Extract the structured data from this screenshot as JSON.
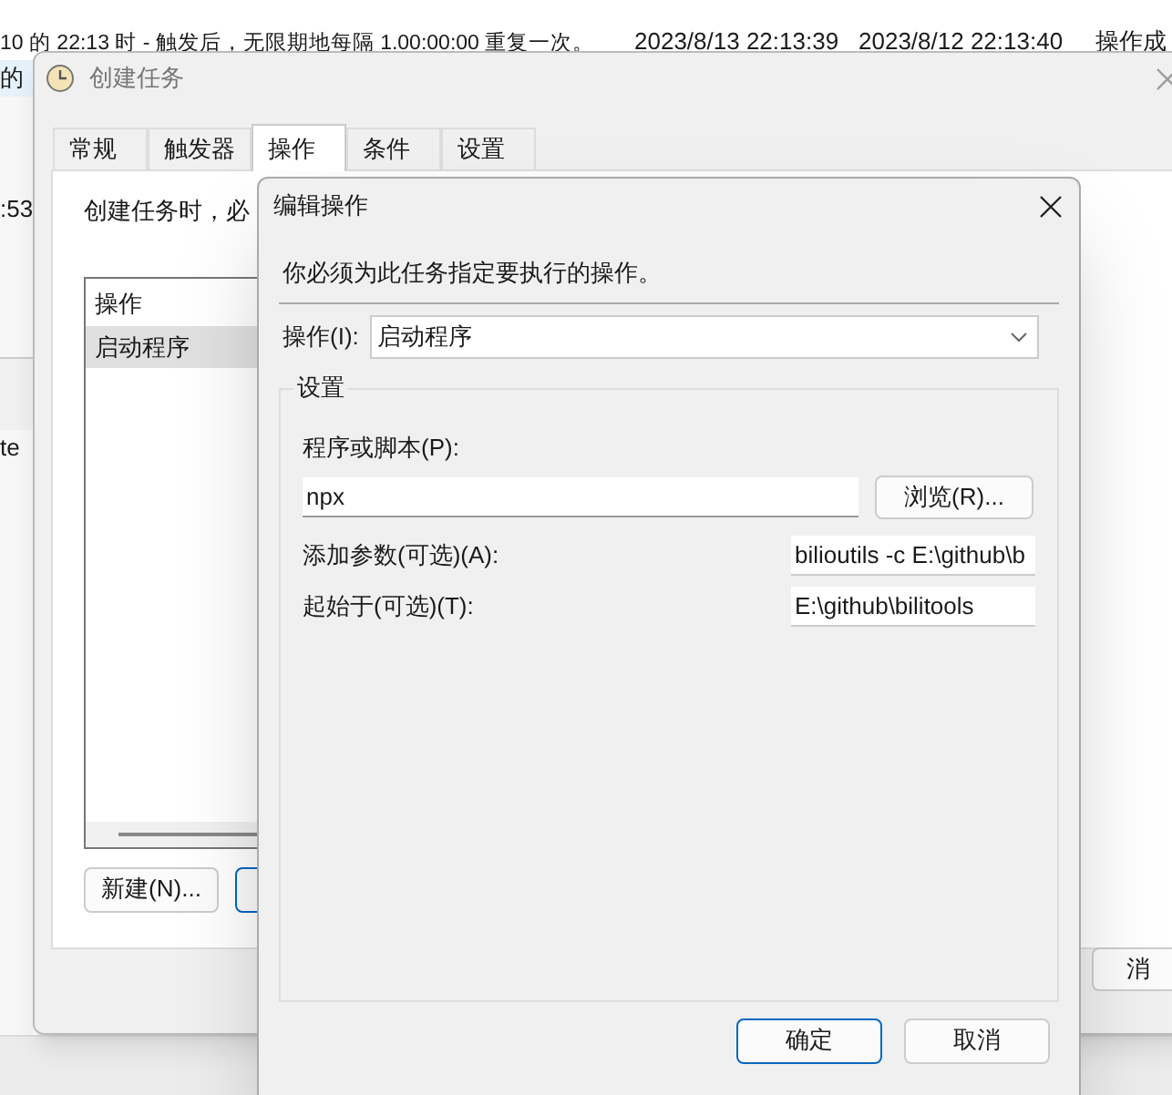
{
  "background_list": {
    "rows": [
      {
        "description": "10 的 22:13 时 - 触发后，无限期地每隔 1.00:00:00 重复一次。",
        "next_run": "2023/8/13 22:13:39",
        "last_run": "2023/8/12 22:13:40",
        "result": "操作成"
      }
    ],
    "fragments": [
      "的",
      ":53",
      "te"
    ]
  },
  "create_task_dialog": {
    "title": "创建任务",
    "tabs": [
      {
        "label": "常规",
        "selected": false
      },
      {
        "label": "触发器",
        "selected": false
      },
      {
        "label": "操作",
        "selected": true
      },
      {
        "label": "条件",
        "selected": false
      },
      {
        "label": "设置",
        "selected": false
      }
    ],
    "intro": "创建任务时，必",
    "actions_list": {
      "header": "操作",
      "rows": [
        {
          "text": "启动程序",
          "selected": true
        }
      ]
    },
    "new_button": "新建(N)...",
    "cancel_button": "消"
  },
  "edit_action_dialog": {
    "title": "编辑操作",
    "instruction": "你必须为此任务指定要执行的操作。",
    "action": {
      "label": "操作(I):",
      "value": "启动程序"
    },
    "group_title": "设置",
    "program": {
      "label": "程序或脚本(P):",
      "value": "npx",
      "browse": "浏览(R)..."
    },
    "arguments": {
      "label": "添加参数(可选)(A):",
      "value": "bilioutils -c E:\\github\\b"
    },
    "start_in": {
      "label": "起始于(可选)(T):",
      "value": "E:\\github\\bilitools"
    },
    "ok": "确定",
    "cancel": "取消"
  }
}
